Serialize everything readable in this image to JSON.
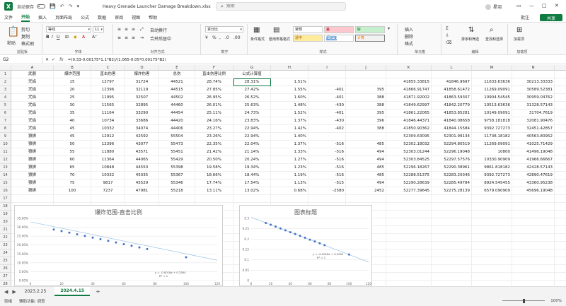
{
  "titlebar": {
    "autosave_label": "自动保存",
    "file_title": "Heavy Grenade Launcher Damage Breakdown.xlsx",
    "search_placeholder": "搜索",
    "user_name": "星羽"
  },
  "menu": {
    "items": [
      "文件",
      "开始",
      "插入",
      "页面布局",
      "公式",
      "数据",
      "审阅",
      "视图",
      "帮助"
    ],
    "active_index": 1,
    "comment_label": "批注",
    "share_label": "共享"
  },
  "ribbon": {
    "clipboard": {
      "paste": "粘贴",
      "cut": "剪切",
      "copy": "复制",
      "format_painter": "格式刷",
      "label": "剪贴板"
    },
    "font": {
      "font_name": "等线",
      "font_size": "11",
      "label": "字体"
    },
    "alignment": {
      "wrap": "自动换行",
      "merge": "合并后居中",
      "label": "对齐方式"
    },
    "number": {
      "format": "百分比",
      "label": "数字"
    },
    "styles": {
      "conditional": "条件格式",
      "table": "套用表格格式",
      "normal": "常规",
      "bad": "差",
      "good": "好",
      "neutral": "适中",
      "link": "超链接",
      "calc": "计算",
      "label": "样式"
    },
    "cells": {
      "insert": "插入",
      "delete": "删除",
      "format": "格式",
      "label": "单元格"
    },
    "editing": {
      "sort": "排序和筛选",
      "find": "查找和选择",
      "label": "编辑"
    },
    "addins": {
      "addin": "加载项",
      "label": "加载项"
    }
  },
  "formula_bar": {
    "name_box": "G2",
    "formula": "=(0.33-0.00175*1.1*B2)/(1.065-0.05*0.00175*B2)"
  },
  "sheet": {
    "columns": [
      "A",
      "B",
      "C",
      "D",
      "E",
      "F",
      "G",
      "H",
      "I",
      "J",
      "K",
      "L",
      "M",
      "N",
      "O"
    ],
    "header_row": [
      "武器",
      "爆炸范围",
      "直击伤害",
      "爆炸伤害",
      "总伤",
      "直击伤害比例",
      "公式计算值",
      "",
      "",
      "",
      "",
      "",
      "",
      "",
      ""
    ],
    "rows": [
      [
        "咒焰",
        "15",
        "12797",
        "31724",
        "44521",
        "28.74%",
        "28.31%",
        "1.51%",
        "",
        "",
        "41855.33815",
        "41846.9697",
        "11633.63636",
        "30213.33333",
        "0.278004272"
      ],
      [
        "咒焰",
        "20",
        "12396",
        "32119",
        "44515",
        "27.85%",
        "27.42%",
        "1.55%",
        "-401",
        "395",
        "41866.91747",
        "41858.61472",
        "11269.09091",
        "30589.52381",
        "0.269217961"
      ],
      [
        "咒焰",
        "25",
        "11995",
        "32507",
        "44502",
        "26.95%",
        "26.52%",
        "1.60%",
        "-401",
        "388",
        "41871.92002",
        "41863.59307",
        "10904.54545",
        "30959.04762",
        "0.260478611"
      ],
      [
        "咒焰",
        "30",
        "11565",
        "32895",
        "44460",
        "26.01%",
        "25.63%",
        "1.48%",
        "-430",
        "388",
        "41849.62997",
        "41842.20779",
        "10513.63636",
        "31328.57143",
        "0.251266661"
      ],
      [
        "咒焰",
        "35",
        "11164",
        "33290",
        "44454",
        "25.11%",
        "24.73%",
        "1.52%",
        "-401",
        "395",
        "41861.22065",
        "41853.85281",
        "10149.09091",
        "31704.7619",
        "0.242488809"
      ],
      [
        "咒焰",
        "40",
        "10734",
        "33686",
        "44420",
        "24.16%",
        "23.83%",
        "1.37%",
        "-430",
        "396",
        "41846.44371",
        "41840.08658",
        "9758.181818",
        "32081.90476",
        "0.23322566"
      ],
      [
        "咒焰",
        "45",
        "10332",
        "34074",
        "44406",
        "23.27%",
        "22.94%",
        "1.42%",
        "-402",
        "388",
        "41850.90362",
        "41844.15584",
        "9392.727273",
        "32451.42857",
        "0.224469274"
      ],
      [
        "狼狮",
        "45",
        "12912",
        "42592",
        "55504",
        "23.26%",
        "22.94%",
        "1.40%",
        "",
        "",
        "52309.63095",
        "52301.99134",
        "11738.18182",
        "40563.80952",
        "0.224430878"
      ],
      [
        "狼狮",
        "50",
        "12396",
        "43077",
        "55473",
        "22.35%",
        "22.04%",
        "1.37%",
        "-516",
        "485",
        "52302.18032",
        "52294.80519",
        "11269.09091",
        "41025.71429",
        "0.215491594"
      ],
      [
        "狼狮",
        "55",
        "11880",
        "43571",
        "55451",
        "21.42%",
        "21.14%",
        "1.33%",
        "-516",
        "494",
        "52303.01244",
        "52296.19048",
        "10800",
        "41496.19048",
        "0.206515999"
      ],
      [
        "狼狮",
        "60",
        "11364",
        "44065",
        "55429",
        "20.50%",
        "20.24%",
        "1.27%",
        "-516",
        "494",
        "52303.84525",
        "52297.57576",
        "10330.90909",
        "41966.66667",
        "0.197540879"
      ],
      [
        "狼狮",
        "65",
        "10848",
        "44550",
        "55398",
        "19.58%",
        "19.34%",
        "1.23%",
        "-516",
        "485",
        "52296.18267",
        "52290.38961",
        "9861.818182",
        "42428.57143",
        "0.188591745"
      ],
      [
        "狼狮",
        "70",
        "10332",
        "45035",
        "55367",
        "18.66%",
        "18.44%",
        "1.19%",
        "-516",
        "485",
        "52288.51375",
        "52283.20346",
        "9392.727273",
        "42890.47619",
        "0.179650952"
      ],
      [
        "狼狮",
        "75",
        "9817",
        "45529",
        "55346",
        "17.74%",
        "17.54%",
        "1.13%",
        "-515",
        "494",
        "52290.28639",
        "52285.49784",
        "8924.545455",
        "43360.95238",
        "0.170688734"
      ],
      [
        "狼狮",
        "100",
        "7237",
        "47981",
        "55218",
        "13.11%",
        "13.02%",
        "0.68%",
        "-2580",
        "2452",
        "52277.39645",
        "52275.28139",
        "6579.090909",
        "45696.19048",
        "0.12585472"
      ]
    ],
    "selected_cell": "G2",
    "visible_rows": 28
  },
  "chart1": {
    "title": "爆炸范围-直击比例",
    "trendline_label": "y = -0.0018x + 0.3304",
    "r2_label": "R² = 1",
    "chart_data": {
      "type": "scatter",
      "title": "爆炸范围-直击比例",
      "xlim": [
        0,
        120
      ],
      "ylim": [
        0,
        0.35
      ],
      "ytick_labels": [
        "0.00%",
        "5.00%",
        "10.00%",
        "15.00%",
        "20.00%",
        "25.00%",
        "30.00%",
        "35.00%"
      ],
      "xticks": [
        0,
        20,
        40,
        60,
        80,
        100,
        120
      ],
      "x": [
        15,
        20,
        25,
        30,
        35,
        40,
        45,
        50,
        55,
        60,
        65,
        70,
        75,
        100
      ],
      "y": [
        0.2874,
        0.2785,
        0.2695,
        0.2601,
        0.2511,
        0.2416,
        0.2327,
        0.2235,
        0.2142,
        0.205,
        0.1958,
        0.1866,
        0.1774,
        0.1311
      ],
      "trendline": {
        "slope": -0.0018,
        "intercept": 0.3304,
        "r2": 1
      }
    }
  },
  "chart2": {
    "title": "图表标题",
    "trendline_label": "y = -0.0018x + 0.3051",
    "r2_label": "R² = 1",
    "chart_data": {
      "type": "scatter",
      "title": "图表标题",
      "xlim": [
        0,
        120
      ],
      "ylim": [
        0,
        0.3
      ],
      "ytick_labels": [
        "0",
        "0.05",
        "0.1",
        "0.15",
        "0.2",
        "0.25",
        "0.3"
      ],
      "xticks": [
        0,
        20,
        40,
        60,
        80,
        100,
        120
      ],
      "x": [
        15,
        20,
        25,
        30,
        35,
        40,
        45,
        50,
        55,
        60,
        65,
        70,
        75,
        100
      ],
      "y": [
        0.278,
        0.2692,
        0.2605,
        0.2513,
        0.2425,
        0.2332,
        0.2245,
        0.2155,
        0.2065,
        0.1975,
        0.1886,
        0.1797,
        0.1707,
        0.1259
      ],
      "trendline": {
        "slope": -0.0018,
        "intercept": 0.3051,
        "r2": 1
      }
    }
  },
  "tabs": {
    "sheets": [
      "2023.2.25",
      "2024.4.15"
    ],
    "active_index": 1,
    "add_label": "+"
  },
  "status": {
    "ready": "就绪",
    "accessibility": "辅助功能: 调查",
    "zoom": "100%"
  }
}
